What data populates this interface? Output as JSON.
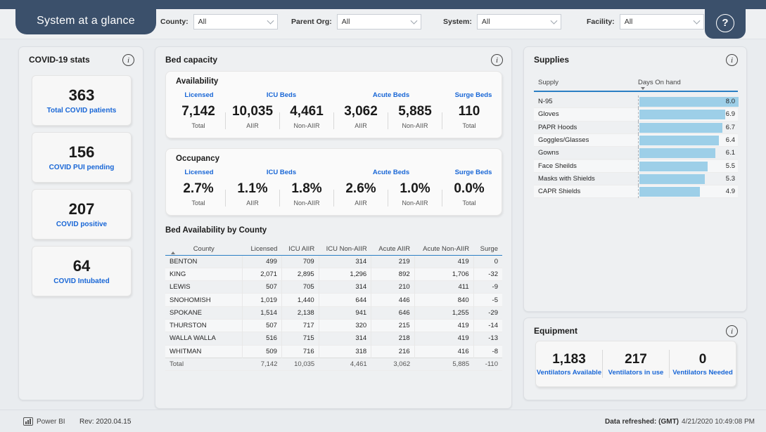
{
  "header": {
    "title": "System at a glance",
    "help_icon": "question-mark-icon",
    "filters": [
      {
        "label": "County:",
        "value": "All"
      },
      {
        "label": "Parent Org:",
        "value": "All"
      },
      {
        "label": "System:",
        "value": "All"
      },
      {
        "label": "Facility:",
        "value": "All"
      }
    ]
  },
  "covid_stats": {
    "title": "COVID-19 stats",
    "info_icon": "info-icon",
    "cards": [
      {
        "value": "363",
        "label": "Total COVID patients"
      },
      {
        "value": "156",
        "label": "COVID PUI pending"
      },
      {
        "value": "207",
        "label": "COVID positive"
      },
      {
        "value": "64",
        "label": "COVID Intubated"
      }
    ]
  },
  "bed_capacity": {
    "title": "Bed capacity",
    "info_icon": "info-icon",
    "availability": {
      "title": "Availability",
      "groups": [
        {
          "name": "Licensed",
          "span": 1
        },
        {
          "name": "ICU Beds",
          "span": 2
        },
        {
          "name": "Acute Beds",
          "span": 2
        },
        {
          "name": "Surge Beds",
          "span": 1
        }
      ],
      "cells": [
        {
          "value": "7,142",
          "sub": "Total"
        },
        {
          "value": "10,035",
          "sub": "AIIR"
        },
        {
          "value": "4,461",
          "sub": "Non-AIIR"
        },
        {
          "value": "3,062",
          "sub": "AIIR"
        },
        {
          "value": "5,885",
          "sub": "Non-AIIR"
        },
        {
          "value": "110",
          "sub": "Total"
        }
      ]
    },
    "occupancy": {
      "title": "Occupancy",
      "groups": [
        {
          "name": "Licensed",
          "span": 1
        },
        {
          "name": "ICU Beds",
          "span": 2
        },
        {
          "name": "Acute Beds",
          "span": 2
        },
        {
          "name": "Surge Beds",
          "span": 1
        }
      ],
      "cells": [
        {
          "value": "2.7%",
          "sub": "Total"
        },
        {
          "value": "1.1%",
          "sub": "AIIR"
        },
        {
          "value": "1.8%",
          "sub": "Non-AIIR"
        },
        {
          "value": "2.6%",
          "sub": "AIIR"
        },
        {
          "value": "1.0%",
          "sub": "Non-AIIR"
        },
        {
          "value": "0.0%",
          "sub": "Total"
        }
      ]
    },
    "table": {
      "title": "Bed Availability by County",
      "columns": [
        "County",
        "Licensed",
        "ICU AIIR",
        "ICU Non-AIIR",
        "Acute AIIR",
        "Acute Non-AIIR",
        "Surge"
      ],
      "sorted_by": "County",
      "sort_direction": "ascending",
      "rows": [
        {
          "county": "BENTON",
          "licensed": "499",
          "icu_aiir": "709",
          "icu_non_aiir": "314",
          "acute_aiir": "219",
          "acute_non_aiir": "419",
          "surge": "0"
        },
        {
          "county": "KING",
          "licensed": "2,071",
          "icu_aiir": "2,895",
          "icu_non_aiir": "1,296",
          "acute_aiir": "892",
          "acute_non_aiir": "1,706",
          "surge": "-32"
        },
        {
          "county": "LEWIS",
          "licensed": "507",
          "icu_aiir": "705",
          "icu_non_aiir": "314",
          "acute_aiir": "210",
          "acute_non_aiir": "411",
          "surge": "-9"
        },
        {
          "county": "SNOHOMISH",
          "licensed": "1,019",
          "icu_aiir": "1,440",
          "icu_non_aiir": "644",
          "acute_aiir": "446",
          "acute_non_aiir": "840",
          "surge": "-5"
        },
        {
          "county": "SPOKANE",
          "licensed": "1,514",
          "icu_aiir": "2,138",
          "icu_non_aiir": "941",
          "acute_aiir": "646",
          "acute_non_aiir": "1,255",
          "surge": "-29"
        },
        {
          "county": "THURSTON",
          "licensed": "507",
          "icu_aiir": "717",
          "icu_non_aiir": "320",
          "acute_aiir": "215",
          "acute_non_aiir": "419",
          "surge": "-14"
        },
        {
          "county": "WALLA WALLA",
          "licensed": "516",
          "icu_aiir": "715",
          "icu_non_aiir": "314",
          "acute_aiir": "218",
          "acute_non_aiir": "419",
          "surge": "-13"
        },
        {
          "county": "WHITMAN",
          "licensed": "509",
          "icu_aiir": "716",
          "icu_non_aiir": "318",
          "acute_aiir": "216",
          "acute_non_aiir": "416",
          "surge": "-8"
        }
      ],
      "total": {
        "county": "Total",
        "licensed": "7,142",
        "icu_aiir": "10,035",
        "icu_non_aiir": "4,461",
        "acute_aiir": "3,062",
        "acute_non_aiir": "5,885",
        "surge": "-110"
      }
    }
  },
  "supplies": {
    "title": "Supplies",
    "info_icon": "info-icon",
    "columns": [
      "Supply",
      "Days On hand"
    ],
    "sorted_by": "Days On hand",
    "sort_direction": "descending",
    "bar_color": "#9dcfe8",
    "max_value": 8.0,
    "rows": [
      {
        "name": "N-95",
        "value": "8.0",
        "num": 8.0
      },
      {
        "name": "Gloves",
        "value": "6.9",
        "num": 6.9
      },
      {
        "name": "PAPR Hoods",
        "value": "6.7",
        "num": 6.7
      },
      {
        "name": "Goggles/Glasses",
        "value": "6.4",
        "num": 6.4
      },
      {
        "name": "Gowns",
        "value": "6.1",
        "num": 6.1
      },
      {
        "name": "Face Sheilds",
        "value": "5.5",
        "num": 5.5
      },
      {
        "name": "Masks with Shields",
        "value": "5.3",
        "num": 5.3
      },
      {
        "name": "CAPR Shields",
        "value": "4.9",
        "num": 4.9
      }
    ]
  },
  "equipment": {
    "title": "Equipment",
    "info_icon": "info-icon",
    "items": [
      {
        "value": "1,183",
        "label": "Ventilators Available"
      },
      {
        "value": "217",
        "label": "Ventilators in use"
      },
      {
        "value": "0",
        "label": "Ventilators Needed"
      }
    ]
  },
  "footer": {
    "brand": "Power BI",
    "brand_icon": "bar-chart-icon",
    "revision": "Rev: 2020.04.15",
    "refreshed_label": "Data refreshed: (GMT)",
    "refreshed_value": "4/21/2020 10:49:08 PM"
  },
  "chart_data": {
    "type": "bar",
    "title": "Supplies",
    "xlabel": "Days On hand",
    "ylabel": "Supply",
    "orientation": "horizontal",
    "categories": [
      "N-95",
      "Gloves",
      "PAPR Hoods",
      "Goggles/Glasses",
      "Gowns",
      "Face Sheilds",
      "Masks with Shields",
      "CAPR Shields"
    ],
    "values": [
      8.0,
      6.9,
      6.7,
      6.4,
      6.1,
      5.5,
      5.3,
      4.9
    ],
    "xlim": [
      0,
      8.0
    ],
    "grid": false,
    "legend": "none",
    "bar_color": "#9dcfe8"
  }
}
